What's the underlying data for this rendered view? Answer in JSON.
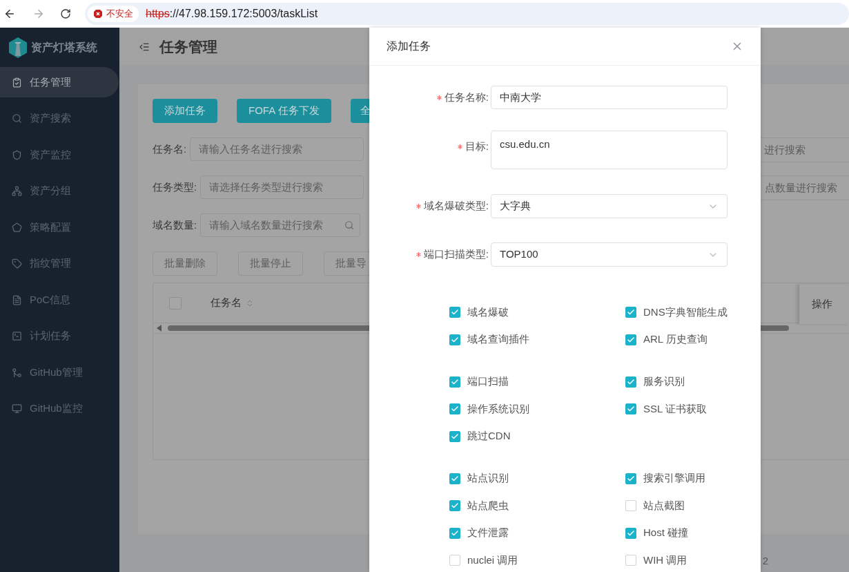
{
  "browser": {
    "security_label": "不安全",
    "url_scheme": "https",
    "url_rest": "://47.98.159.172:5003/taskList"
  },
  "sidebar": {
    "app_name": "资产灯塔系统",
    "items": [
      {
        "label": "任务管理",
        "selected": true
      },
      {
        "label": "资产搜索",
        "selected": false
      },
      {
        "label": "资产监控",
        "selected": false
      },
      {
        "label": "资产分组",
        "selected": false
      },
      {
        "label": "策略配置",
        "selected": false
      },
      {
        "label": "指纹管理",
        "selected": false
      },
      {
        "label": "PoC信息",
        "selected": false
      },
      {
        "label": "计划任务",
        "selected": false
      },
      {
        "label": "GitHub管理",
        "selected": false
      },
      {
        "label": "GitHub监控",
        "selected": false
      }
    ]
  },
  "page": {
    "title": "任务管理",
    "action_buttons": [
      "添加任务",
      "FOFA 任务下发",
      "全"
    ],
    "filters": [
      {
        "label": "任务名:",
        "placeholder": "请输入任务名进行搜索"
      },
      {
        "label": "任务类型:",
        "placeholder": "请选择任务类型进行搜索"
      },
      {
        "label": "域名数量:",
        "placeholder": "请输入域名数量进行搜索"
      }
    ],
    "right_filters": [
      {
        "placeholder": "进行搜索"
      },
      {
        "placeholder": "点数量进行搜索"
      }
    ],
    "batch_buttons": [
      "批量删除",
      "批量停止",
      "批量导"
    ],
    "table": {
      "columns": [
        {
          "label": "任务名"
        }
      ],
      "right_column": "操作",
      "select_all_checked": false
    },
    "pagination_fragment": "2"
  },
  "dialog": {
    "title": "添加任务",
    "fields": [
      {
        "kind": "input",
        "label": "任务名称:",
        "required": true,
        "value": "中南大学"
      },
      {
        "kind": "textarea",
        "label": "目标:",
        "required": true,
        "value": "csu.edu.cn"
      },
      {
        "kind": "select",
        "label": "域名爆破类型:",
        "required": true,
        "value": "大字典"
      },
      {
        "kind": "select",
        "label": "端口扫描类型:",
        "required": true,
        "value": "TOP100"
      }
    ],
    "option_groups": [
      [
        {
          "label": "域名爆破",
          "checked": true
        },
        {
          "label": "DNS字典智能生成",
          "checked": true
        },
        {
          "label": "域名查询插件",
          "checked": true
        },
        {
          "label": "ARL 历史查询",
          "checked": true
        }
      ],
      [
        {
          "label": "端口扫描",
          "checked": true
        },
        {
          "label": "服务识别",
          "checked": true
        },
        {
          "label": "操作系统识别",
          "checked": true
        },
        {
          "label": "SSL 证书获取",
          "checked": true
        },
        {
          "label": "跳过CDN",
          "checked": true
        }
      ],
      [
        {
          "label": "站点识别",
          "checked": true
        },
        {
          "label": "搜索引擎调用",
          "checked": true
        },
        {
          "label": "站点爬虫",
          "checked": true
        },
        {
          "label": "站点截图",
          "checked": false
        },
        {
          "label": "文件泄露",
          "checked": true
        },
        {
          "label": "Host 碰撞",
          "checked": true
        },
        {
          "label": "nuclei 调用",
          "checked": false
        },
        {
          "label": "WIH 调用",
          "checked": false
        }
      ]
    ]
  }
}
